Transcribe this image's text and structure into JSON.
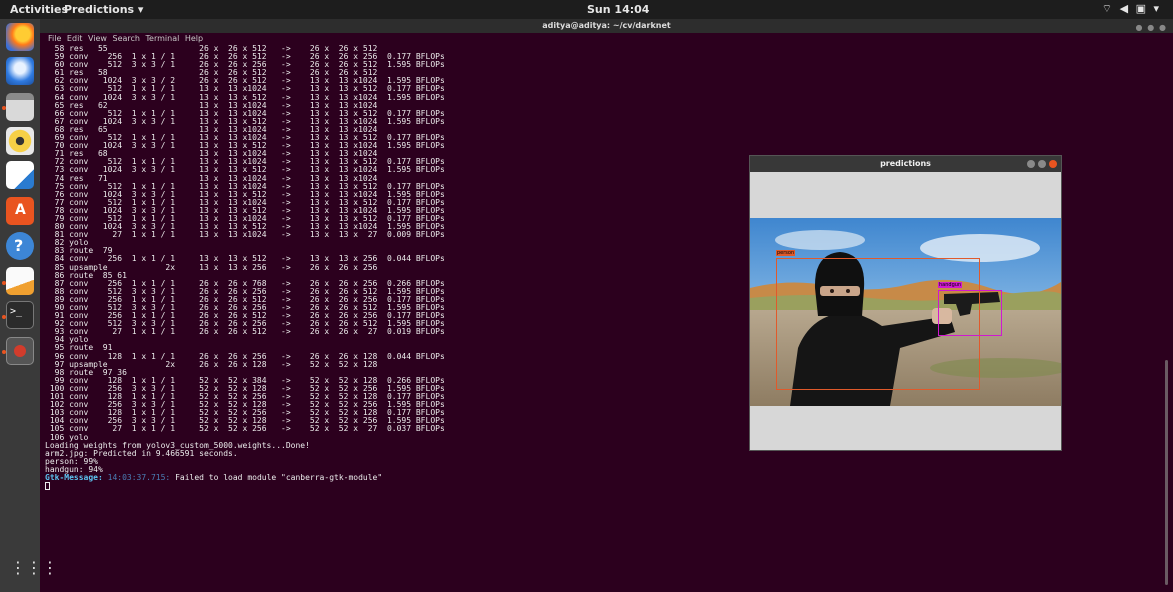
{
  "topbar": {
    "activities": "Activities",
    "app_menu": "Predictions ▾",
    "clock": "Sun 14:04",
    "tray": "⌔ ◀ ▣ ▾"
  },
  "terminal": {
    "title": "aditya@aditya: ~/cv/darknet",
    "menu": "File  Edit  View  Search  Terminal  Help",
    "lines": [
      "  58 res   55                   26 x  26 x 512   ->    26 x  26 x 512",
      "  59 conv    256  1 x 1 / 1     26 x  26 x 512   ->    26 x  26 x 256  0.177 BFLOPs",
      "  60 conv    512  3 x 3 / 1     26 x  26 x 256   ->    26 x  26 x 512  1.595 BFLOPs",
      "  61 res   58                   26 x  26 x 512   ->    26 x  26 x 512",
      "  62 conv   1024  3 x 3 / 2     26 x  26 x 512   ->    13 x  13 x1024  1.595 BFLOPs",
      "  63 conv    512  1 x 1 / 1     13 x  13 x1024   ->    13 x  13 x 512  0.177 BFLOPs",
      "  64 conv   1024  3 x 3 / 1     13 x  13 x 512   ->    13 x  13 x1024  1.595 BFLOPs",
      "  65 res   62                   13 x  13 x1024   ->    13 x  13 x1024",
      "  66 conv    512  1 x 1 / 1     13 x  13 x1024   ->    13 x  13 x 512  0.177 BFLOPs",
      "  67 conv   1024  3 x 3 / 1     13 x  13 x 512   ->    13 x  13 x1024  1.595 BFLOPs",
      "  68 res   65                   13 x  13 x1024   ->    13 x  13 x1024",
      "  69 conv    512  1 x 1 / 1     13 x  13 x1024   ->    13 x  13 x 512  0.177 BFLOPs",
      "  70 conv   1024  3 x 3 / 1     13 x  13 x 512   ->    13 x  13 x1024  1.595 BFLOPs",
      "  71 res   68                   13 x  13 x1024   ->    13 x  13 x1024",
      "  72 conv    512  1 x 1 / 1     13 x  13 x1024   ->    13 x  13 x 512  0.177 BFLOPs",
      "  73 conv   1024  3 x 3 / 1     13 x  13 x 512   ->    13 x  13 x1024  1.595 BFLOPs",
      "  74 res   71                   13 x  13 x1024   ->    13 x  13 x1024",
      "  75 conv    512  1 x 1 / 1     13 x  13 x1024   ->    13 x  13 x 512  0.177 BFLOPs",
      "  76 conv   1024  3 x 3 / 1     13 x  13 x 512   ->    13 x  13 x1024  1.595 BFLOPs",
      "  77 conv    512  1 x 1 / 1     13 x  13 x1024   ->    13 x  13 x 512  0.177 BFLOPs",
      "  78 conv   1024  3 x 3 / 1     13 x  13 x 512   ->    13 x  13 x1024  1.595 BFLOPs",
      "  79 conv    512  1 x 1 / 1     13 x  13 x1024   ->    13 x  13 x 512  0.177 BFLOPs",
      "  80 conv   1024  3 x 3 / 1     13 x  13 x 512   ->    13 x  13 x1024  1.595 BFLOPs",
      "  81 conv     27  1 x 1 / 1     13 x  13 x1024   ->    13 x  13 x  27  0.009 BFLOPs",
      "  82 yolo",
      "  83 route  79",
      "  84 conv    256  1 x 1 / 1     13 x  13 x 512   ->    13 x  13 x 256  0.044 BFLOPs",
      "  85 upsample            2x     13 x  13 x 256   ->    26 x  26 x 256",
      "  86 route  85 61",
      "  87 conv    256  1 x 1 / 1     26 x  26 x 768   ->    26 x  26 x 256  0.266 BFLOPs",
      "  88 conv    512  3 x 3 / 1     26 x  26 x 256   ->    26 x  26 x 512  1.595 BFLOPs",
      "  89 conv    256  1 x 1 / 1     26 x  26 x 512   ->    26 x  26 x 256  0.177 BFLOPs",
      "  90 conv    512  3 x 3 / 1     26 x  26 x 256   ->    26 x  26 x 512  1.595 BFLOPs",
      "  91 conv    256  1 x 1 / 1     26 x  26 x 512   ->    26 x  26 x 256  0.177 BFLOPs",
      "  92 conv    512  3 x 3 / 1     26 x  26 x 256   ->    26 x  26 x 512  1.595 BFLOPs",
      "  93 conv     27  1 x 1 / 1     26 x  26 x 512   ->    26 x  26 x  27  0.019 BFLOPs",
      "  94 yolo",
      "  95 route  91",
      "  96 conv    128  1 x 1 / 1     26 x  26 x 256   ->    26 x  26 x 128  0.044 BFLOPs",
      "  97 upsample            2x     26 x  26 x 128   ->    52 x  52 x 128",
      "  98 route  97 36",
      "  99 conv    128  1 x 1 / 1     52 x  52 x 384   ->    52 x  52 x 128  0.266 BFLOPs",
      " 100 conv    256  3 x 3 / 1     52 x  52 x 128   ->    52 x  52 x 256  1.595 BFLOPs",
      " 101 conv    128  1 x 1 / 1     52 x  52 x 256   ->    52 x  52 x 128  0.177 BFLOPs",
      " 102 conv    256  3 x 3 / 1     52 x  52 x 128   ->    52 x  52 x 256  1.595 BFLOPs",
      " 103 conv    128  1 x 1 / 1     52 x  52 x 256   ->    52 x  52 x 128  0.177 BFLOPs",
      " 104 conv    256  3 x 3 / 1     52 x  52 x 128   ->    52 x  52 x 256  1.595 BFLOPs",
      " 105 conv     27  1 x 1 / 1     52 x  52 x 256   ->    52 x  52 x  27  0.037 BFLOPs",
      " 106 yolo",
      "Loading weights from yolov3_custom_5000.weights...Done!",
      "arm2.jpg: Predicted in 9.466591 seconds.",
      "person: 99%",
      "handgun: 94%"
    ],
    "gtk_label": "Gtk-Message:",
    "gtk_time": "14:03:37.715:",
    "gtk_text": " Failed to load module \"canberra-gtk-module\""
  },
  "predictions_window": {
    "title": "predictions",
    "person_label": "person",
    "handgun_label": "handgun",
    "colors": {
      "person_box": "#e05a2b",
      "handgun_box": "#d018d0"
    }
  },
  "dock_icons": [
    "firefox-icon",
    "thunderbird-icon",
    "files-icon",
    "rhythmbox-icon",
    "libreoffice-writer-icon",
    "software-center-icon",
    "help-icon",
    "text-editor-icon",
    "terminal-icon",
    "screenshot-icon",
    "show-applications-icon"
  ]
}
